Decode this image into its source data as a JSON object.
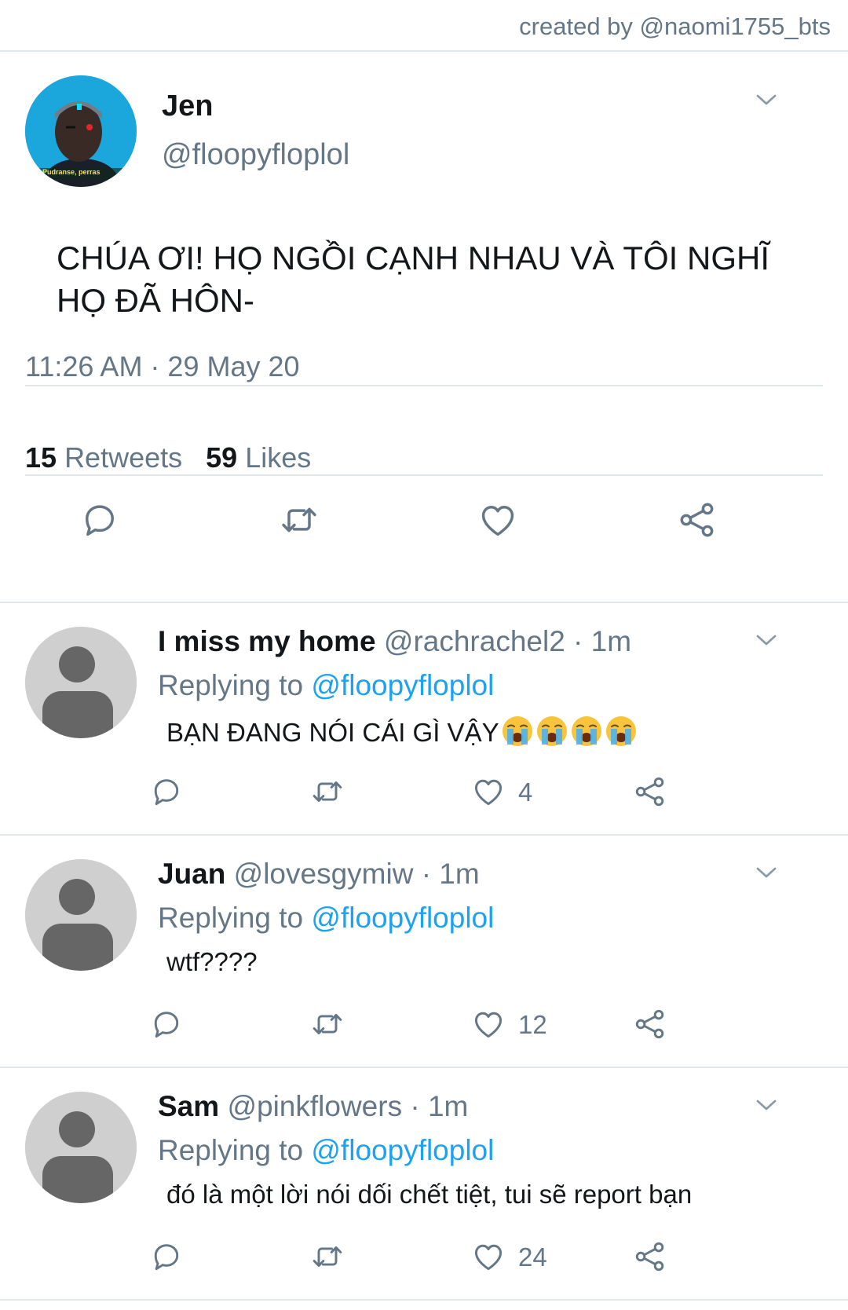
{
  "credit": "created by @naomi1755_bts",
  "main_tweet": {
    "avatar_icon": "cyborg-avatar",
    "avatar_caption": "Pudranse, perras",
    "name": "Jen",
    "handle": "@floopyfloplol",
    "text_line1": "CHÚA ƠI! HỌ NGỒI CẠNH NHAU VÀ TÔI NGHĨ",
    "text_line2": "HỌ ĐÃ HÔN-",
    "timestamp": "11:26 AM · 29 May 20",
    "retweets_count": "15",
    "retweets_label": "Retweets",
    "likes_count": "59",
    "likes_label": "Likes"
  },
  "replies": [
    {
      "name": "I miss my home",
      "meta": "@rachrachel2 · 1m",
      "replying_label": "Replying to",
      "replying_to": "@floopyfloplol",
      "text": "BẠN ĐANG NÓI CÁI GÌ VẬY",
      "emoji": "loudly-crying-face",
      "emoji_count": 4,
      "likes": "4"
    },
    {
      "name": "Juan",
      "meta": "@lovesgymiw · 1m",
      "replying_label": "Replying to",
      "replying_to": "@floopyfloplol",
      "text": "wtf????",
      "likes": "12"
    },
    {
      "name": "Sam",
      "meta": "@pinkflowers · 1m",
      "replying_label": "Replying to",
      "replying_to": "@floopyfloplol",
      "text": "đó là một lời nói dối chết tiệt, tui sẽ report bạn",
      "likes": "24"
    }
  ],
  "colors": {
    "link": "#1da1f2",
    "secondary_text": "#657786",
    "primary_text": "#14171a",
    "divider": "#e1e8ed",
    "default_avatar_bg": "#cfcfcf",
    "default_avatar_fg": "#666666"
  }
}
